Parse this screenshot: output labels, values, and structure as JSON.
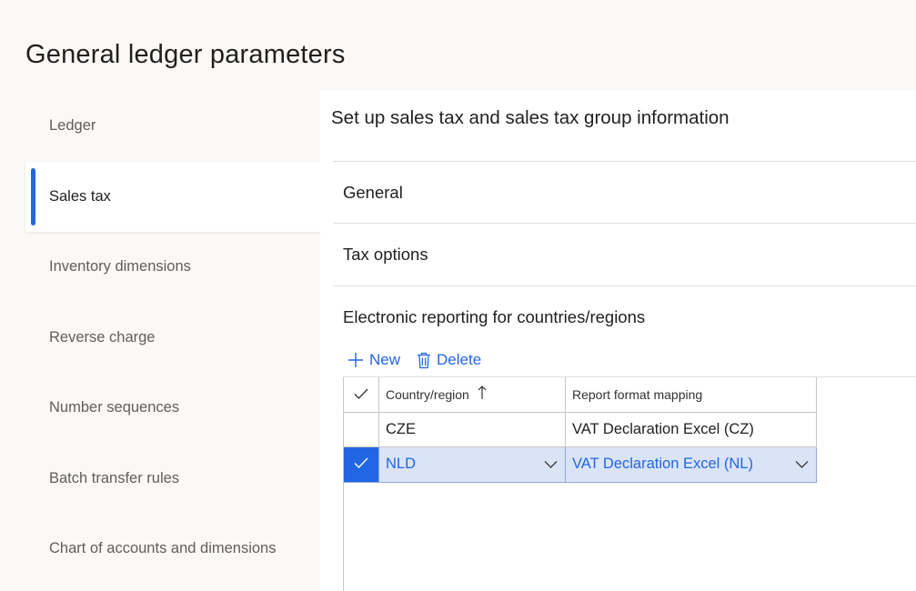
{
  "page_title": "General ledger parameters",
  "nav": {
    "items": [
      {
        "label": "Ledger"
      },
      {
        "label": "Sales tax"
      },
      {
        "label": "Inventory dimensions"
      },
      {
        "label": "Reverse charge"
      },
      {
        "label": "Number sequences"
      },
      {
        "label": "Batch transfer rules"
      },
      {
        "label": "Chart of accounts and dimensions"
      }
    ],
    "active_index": 1
  },
  "main": {
    "heading": "Set up sales tax and sales tax group information",
    "fasttabs": [
      {
        "label": "General"
      },
      {
        "label": "Tax options"
      },
      {
        "label": "Electronic reporting for countries/regions"
      }
    ],
    "toolbar": {
      "new_label": "New",
      "new_icon": "plus-icon",
      "delete_label": "Delete",
      "delete_icon": "trash-icon"
    },
    "grid": {
      "columns": [
        "Country/region",
        "Report format mapping"
      ],
      "sort_icon": "sort-ascending-icon",
      "rows": [
        {
          "country": "CZE",
          "mapping": "VAT Declaration Excel (CZ)",
          "selected": false
        },
        {
          "country": "NLD",
          "mapping": "VAT Declaration Excel (NL)",
          "selected": true
        }
      ]
    }
  },
  "colors": {
    "accent": "#2266e3",
    "selected_row": "#dae4f7",
    "background": "#faf9f8",
    "panel": "#ffffff"
  }
}
